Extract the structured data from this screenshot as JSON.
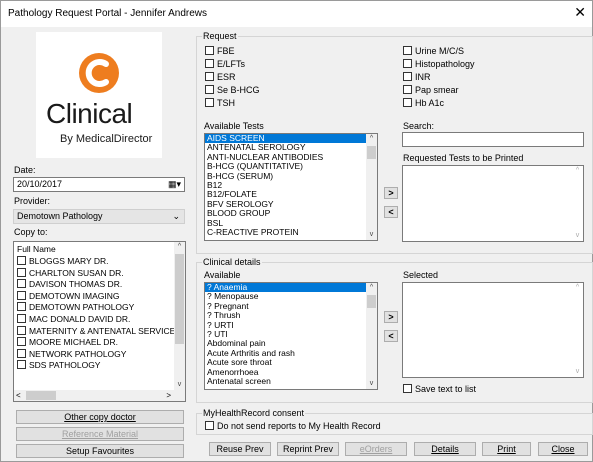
{
  "window": {
    "title": "Pathology Request Portal - Jennifer Andrews"
  },
  "logo": {
    "main": "Clinical",
    "sub": "By MedicalDirector",
    "accent": "#ee7d1f"
  },
  "date": {
    "label": "Date:",
    "value": "20/10/2017"
  },
  "provider": {
    "label": "Provider:",
    "value": "Demotown Pathology"
  },
  "copy_to": {
    "label": "Copy to:",
    "header": "Full Name",
    "items": [
      "BLOGGS MARY DR.",
      "CHARLTON SUSAN DR.",
      "DAVISON THOMAS DR.",
      "DEMOTOWN IMAGING",
      "DEMOTOWN PATHOLOGY",
      "MAC DONALD DAVID DR.",
      "MATERNITY & ANTENATAL SERVICE",
      "MOORE MICHAEL DR.",
      "NETWORK PATHOLOGY",
      "SDS PATHOLOGY"
    ]
  },
  "left_buttons": {
    "other_copy": "Other copy doctor",
    "reference": "Reference Material",
    "setup": "Setup Favourites"
  },
  "request": {
    "label": "Request",
    "left_checks": [
      "FBE",
      "E/LFTs",
      "ESR",
      "Se B-HCG",
      "TSH"
    ],
    "right_checks": [
      "Urine M/C/S",
      "Histopathology",
      "INR",
      "Pap smear",
      "Hb A1c"
    ]
  },
  "available_tests": {
    "label": "Available Tests",
    "items": [
      "AIDS SCREEN",
      "ANTENATAL SEROLOGY",
      "ANTI-NUCLEAR ANTIBODIES",
      "B-HCG (QUANTITATIVE)",
      "B-HCG (SERUM)",
      "B12",
      "B12/FOLATE",
      "BFV SEROLOGY",
      "BLOOD GROUP",
      "BSL",
      "C-REACTIVE PROTEIN"
    ],
    "selected_index": 0
  },
  "search": {
    "label": "Search:",
    "value": ""
  },
  "requested": {
    "label": "Requested Tests to be Printed"
  },
  "move": {
    "add": ">",
    "remove": "<"
  },
  "clinical": {
    "label": "Clinical details",
    "available_label": "Available",
    "items": [
      "? Anaemia",
      "? Menopause",
      "? Pregnant",
      "? Thrush",
      "? URTI",
      "? UTI",
      "Abdominal pain",
      "Acute Arthritis and rash",
      "Acute sore throat",
      "Amenorrhoea",
      "Antenatal screen"
    ],
    "selected_index": 0,
    "selected_label": "Selected",
    "save_text": "Save text to list"
  },
  "mhr": {
    "label": "MyHealthRecord consent",
    "checkbox": "Do not send reports to My Health Record"
  },
  "bottom_buttons": {
    "reuse": "Reuse Prev",
    "reprint": "Reprint Prev",
    "eorders": "eOrders",
    "details": "Details",
    "print": "Print",
    "close": "Close"
  }
}
